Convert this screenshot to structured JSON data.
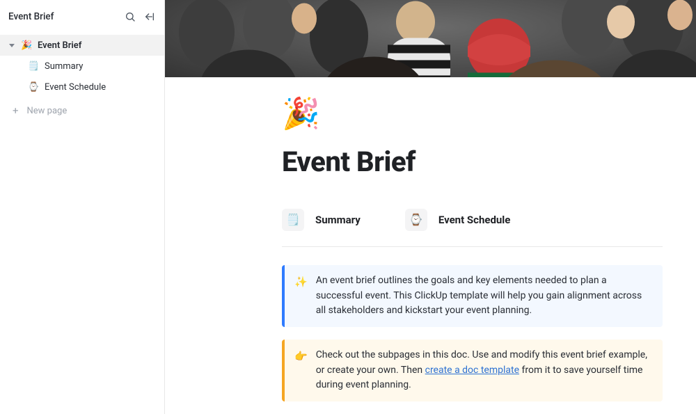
{
  "sidebar": {
    "title": "Event Brief",
    "new_page_label": "New page",
    "items": [
      {
        "emoji": "🎉",
        "label": "Event Brief",
        "selected": true,
        "has_children": true
      },
      {
        "emoji": "🗒️",
        "label": "Summary",
        "selected": false,
        "child": true
      },
      {
        "emoji": "⌚",
        "label": "Event Schedule",
        "selected": false,
        "child": true
      }
    ]
  },
  "doc": {
    "icon": "🎉",
    "title": "Event Brief",
    "subpages": [
      {
        "emoji": "🗒️",
        "label": "Summary"
      },
      {
        "emoji": "⌚",
        "label": "Event Schedule"
      }
    ],
    "callouts": {
      "blue": {
        "emoji": "✨",
        "text": "An event brief outlines the goals and key elements needed to plan a successful event. This ClickUp template will help you gain alignment across all stakeholders and kickstart your event planning."
      },
      "orange": {
        "emoji": "👉",
        "text_before": "Check out the subpages in this doc. Use and modify this event brief example, or create your own. Then ",
        "link_text": "create a doc template",
        "text_after": " from it to save yourself time during event planning."
      }
    }
  }
}
